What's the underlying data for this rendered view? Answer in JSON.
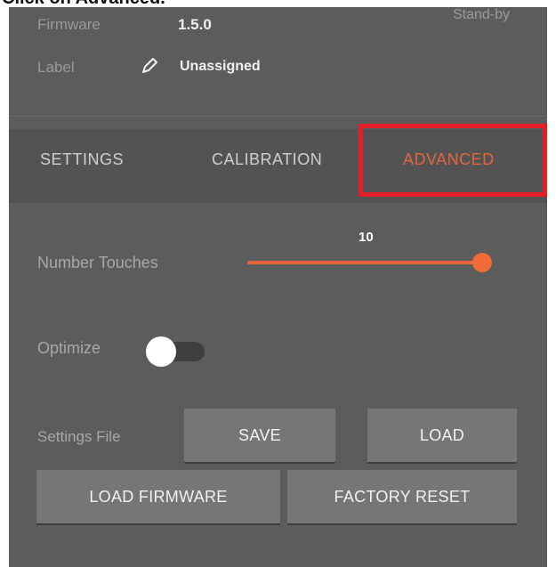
{
  "caption": "Click on Advanced.",
  "device": {
    "firmware_label": "Firmware",
    "firmware_value": "1.5.0",
    "label_label": "Label",
    "label_value": "Unassigned",
    "status": "Stand-by"
  },
  "tabs": [
    {
      "label": "SETTINGS",
      "active": false
    },
    {
      "label": "CALIBRATION",
      "active": false
    },
    {
      "label": "ADVANCED",
      "active": true
    }
  ],
  "advanced": {
    "touches_label": "Number Touches",
    "touches_value": "10",
    "touches_fraction": 1.0,
    "optimize_label": "Optimize",
    "optimize_on": false,
    "settings_file_label": "Settings File",
    "save_label": "SAVE",
    "load_label": "LOAD",
    "load_firmware_label": "LOAD FIRMWARE",
    "factory_reset_label": "FACTORY RESET"
  },
  "colors": {
    "accent": "#e4643a",
    "highlight": "#e41e26",
    "panel": "#5c5c5c"
  },
  "icons": {
    "label_edit": "pencil-icon"
  }
}
